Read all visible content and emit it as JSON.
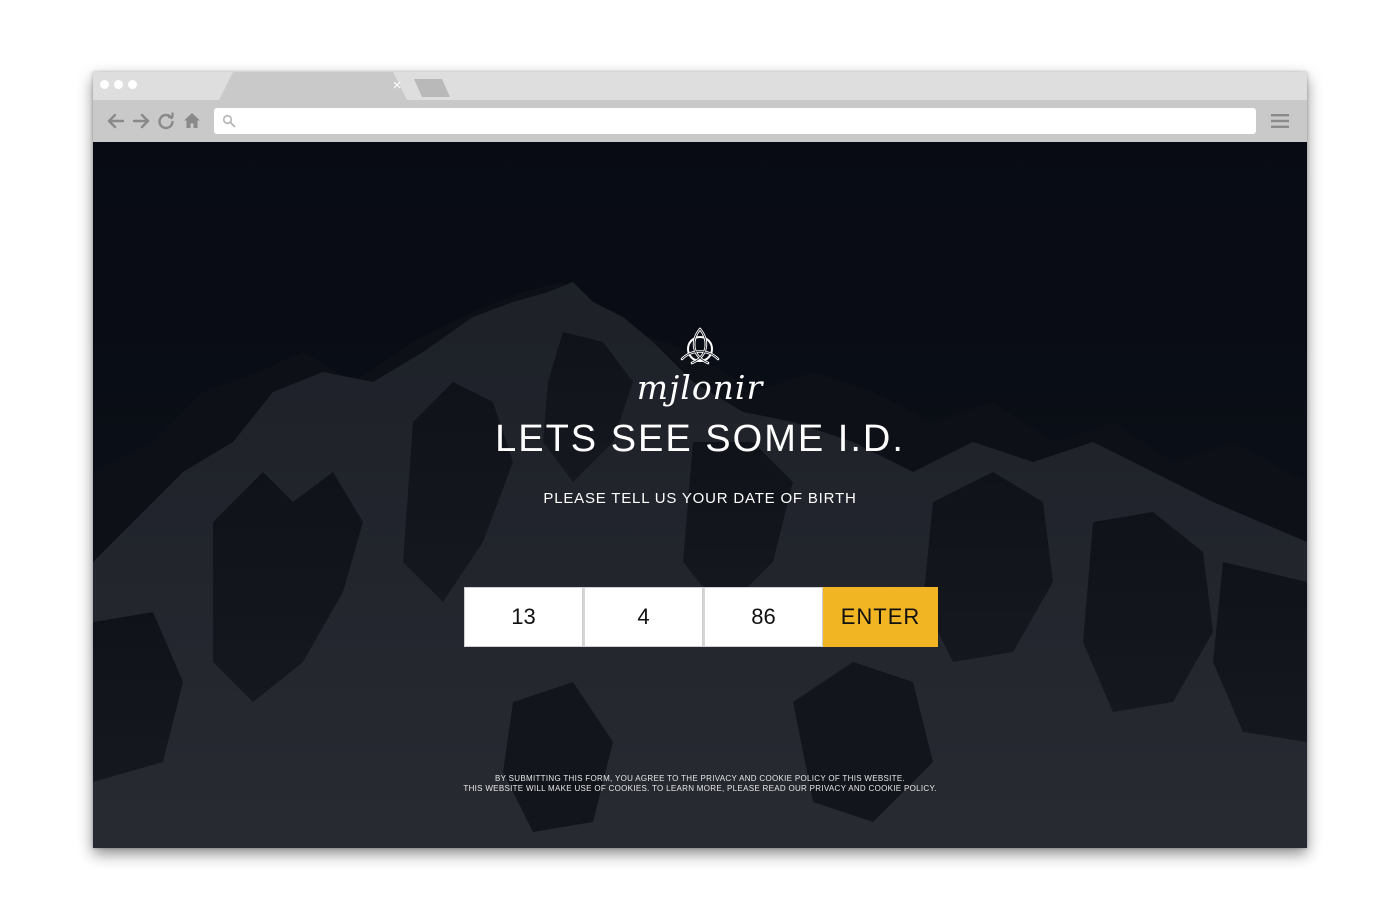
{
  "browser": {
    "tab_close_glyph": "×",
    "icons": {
      "back": "back-arrow-icon",
      "forward": "forward-arrow-icon",
      "reload": "reload-icon",
      "home": "home-icon",
      "search": "search-icon",
      "menu": "hamburger-menu-icon",
      "tab_close": "close-icon"
    },
    "address": {
      "value": "",
      "placeholder": ""
    }
  },
  "page": {
    "brand": "mjlonir",
    "headline": "LETS SEE SOME I.D.",
    "subtitle": "PLEASE TELL US YOUR DATE OF BIRTH",
    "dob": {
      "day": "13",
      "month": "4",
      "year": "86"
    },
    "enter_label": "ENTER",
    "legal_line_1": "BY SUBMITTING THIS FORM, YOU AGREE TO THE PRIVACY AND COOKIE POLICY OF THIS WEBSITE.",
    "legal_line_2": "THIS WEBSITE WILL MAKE USE OF COOKIES. TO LEARN MORE, PLEASE READ OUR PRIVACY AND COOKIE POLICY.",
    "logo_icon": "celtic-knot-icon",
    "background_image": "snowy-mountain-photo"
  },
  "colors": {
    "accent": "#f1b524",
    "chrome_titlebar": "#dedede",
    "chrome_toolbar": "#c9c9c9",
    "page_background": "#0c0f17",
    "text": "#ffffff"
  }
}
